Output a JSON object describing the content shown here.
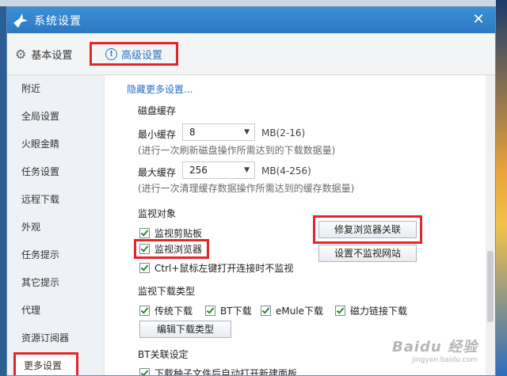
{
  "window": {
    "title": "系统设置",
    "close_label": "✕"
  },
  "tabs": {
    "basic": "基本设置",
    "advanced": "高级设置"
  },
  "sidebar": {
    "items": [
      {
        "label": "附近"
      },
      {
        "label": "全局设置"
      },
      {
        "label": "火眼金睛"
      },
      {
        "label": "任务设置"
      },
      {
        "label": "远程下载"
      },
      {
        "label": "外观"
      },
      {
        "label": "任务提示"
      },
      {
        "label": "其它提示"
      },
      {
        "label": "代理"
      },
      {
        "label": "资源订阅器"
      },
      {
        "label": "更多设置"
      }
    ]
  },
  "main": {
    "hide_link": "隐藏更多设置...",
    "disk_cache": {
      "title": "磁盘缓存",
      "min_label": "最小缓存",
      "min_value": "8",
      "min_range": "MB(2-16)",
      "min_hint": "(进行一次刷新磁盘操作所需达到的下载数据量)",
      "max_label": "最大缓存",
      "max_value": "256",
      "max_range": "MB(4-256)",
      "max_hint": "(进行一次清理缓存数据操作所需达到的缓存数据量)"
    },
    "monitor": {
      "title": "监视对象",
      "clipboard": "监视剪贴板",
      "browser": "监视浏览器",
      "ctrl_click": "Ctrl+鼠标左键打开连接时不监视",
      "repair_button": "修复浏览器关联",
      "no_monitor_button": "设置不监视网站"
    },
    "download_types": {
      "title": "监视下载类型",
      "traditional": "传统下载",
      "bt": "BT下载",
      "emule": "eMule下载",
      "magnet": "磁力链接下载",
      "edit_button": "编辑下载类型"
    },
    "bt_assoc": {
      "title": "BT关联设定",
      "auto_open": "下载种子文件后自动打开新建面板"
    }
  },
  "watermark": {
    "main": "Baidu 经验",
    "sub": "jingyan.baidu.com"
  },
  "colors": {
    "accent": "#2b74c4",
    "highlight_box": "#e3262c",
    "titlebar": "#2c78c2"
  }
}
